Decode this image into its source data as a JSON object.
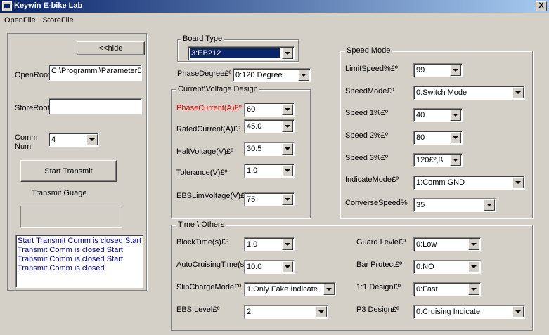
{
  "window": {
    "title": "Keywin E-bike Lab",
    "close_glyph": "X"
  },
  "menu": {
    "open": "OpenFile",
    "store": "StoreFile"
  },
  "left": {
    "hide_button": "<<hide",
    "open_root_label": "OpenRoot",
    "open_root_value": "C:\\Programmi\\ParameterD",
    "store_root_label": "StoreRoot",
    "store_root_value": "",
    "comm_label_1": "Comm",
    "comm_label_2": "Num",
    "comm_value": "4",
    "start_button": "Start Transmit",
    "gauge_label": "Transmit Guage",
    "log_lines": [
      "Start Transmit Comm is closed Start",
      "Transmit Comm is closed Start",
      "Transmit Comm is closed Start",
      "Transmit Comm is closed"
    ]
  },
  "board": {
    "label": "Board Type",
    "value": "3:EB212"
  },
  "phase_degree": {
    "label": "PhaseDegree£º",
    "value": "0:120 Degree"
  },
  "current_voltage": {
    "title": "Current\\Voltage Design",
    "fields": [
      {
        "label": "PhaseCurrent(A)£º",
        "value": "60"
      },
      {
        "label": "RatedCurrent(A)£º",
        "value": "45.0"
      },
      {
        "label": "HaltVoltage(V)£º",
        "value": "30.5"
      },
      {
        "label": "Tolerance(V)£º",
        "value": "1.0"
      },
      {
        "label": "EBSLimVoltage(V)£º",
        "value": "75"
      }
    ]
  },
  "speed_mode": {
    "title": "Speed Mode",
    "fields": [
      {
        "label": "LimitSpeed%£º",
        "value": "99"
      },
      {
        "label": "SpeedMode£º",
        "value": "0:Switch Mode"
      },
      {
        "label": "Speed 1%£º",
        "value": "40"
      },
      {
        "label": "Speed 2%£º",
        "value": "80"
      },
      {
        "label": "Speed 3%£º",
        "value": "120£º,ß"
      },
      {
        "label": "IndicateMode£º",
        "value": "1:Comm GND"
      },
      {
        "label": "ConverseSpeed%",
        "value": "35"
      }
    ]
  },
  "time_others": {
    "title": "Time \\ Others",
    "left_fields": [
      {
        "label": "BlockTime(s)£º",
        "value": "1.0"
      },
      {
        "label": "AutoCruisingTime(s)£º",
        "value": "10.0"
      },
      {
        "label": "SlipChargeMode£º",
        "value": "1:Only Fake Indicate"
      },
      {
        "label": "EBS Level£º",
        "value": "2:"
      }
    ],
    "right_fields": [
      {
        "label": "Guard Levle£º",
        "value": "0:Low"
      },
      {
        "label": "Bar Protect£º",
        "value": "0:NO"
      },
      {
        "label": "1:1 Design£º",
        "value": "0:Fast"
      },
      {
        "label": "P3 Design£º",
        "value": "0:Cruising Indicate"
      }
    ]
  }
}
